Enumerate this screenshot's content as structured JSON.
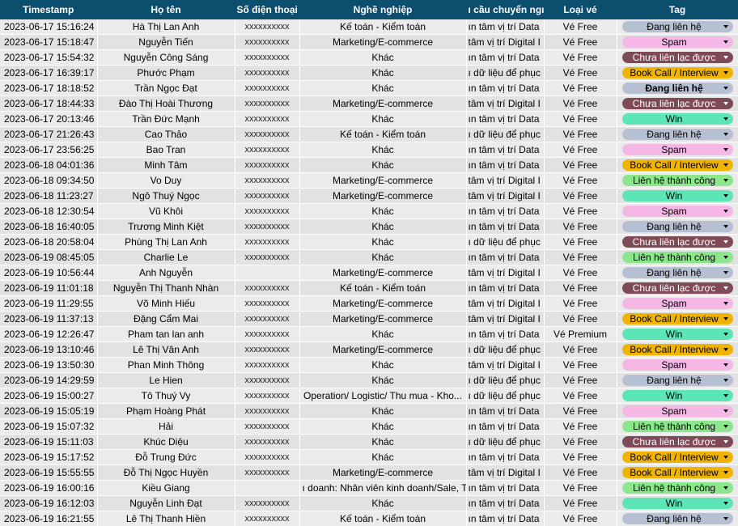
{
  "headers": [
    "Timestamp",
    "Họ tên",
    "Số điện thoại",
    "Nghề nghiệp",
    "ı cầu chuyển ngı",
    "Loại vé",
    "Tag"
  ],
  "tag_styles": {
    "Đang liên hệ": "lien",
    "Spam": "spam",
    "Chưa liên lạc được": "chua",
    "Book Call / Interview": "book",
    "Win": "win",
    "Liên hệ thành công": "thanh"
  },
  "rows": [
    {
      "ts": "2023-06-17 15:16:24",
      "name": "Hà Thị Lan Anh",
      "phone": "xxxxxxxxxx",
      "job": "Kế toán - Kiểm toán",
      "need": "ın tâm vị trí Data",
      "ticket": "Vé Free",
      "tag": "Đang liên hệ"
    },
    {
      "ts": "2023-06-17 15:18:47",
      "name": "Nguyễn Tiến",
      "phone": "xxxxxxxxxx",
      "job": "Marketing/E-commerce",
      "need": "tâm vị trí Digital I",
      "ticket": "Vé Free",
      "tag": "Spam"
    },
    {
      "ts": "2023-06-17 15:54:32",
      "name": "Nguyễn Công Sáng",
      "phone": "xxxxxxxxxx",
      "job": "Khác",
      "need": "ın tâm vị trí Data",
      "ticket": "Vé Free",
      "tag": "Chưa liên lạc được"
    },
    {
      "ts": "2023-06-17 16:39:17",
      "name": "Phước Phạm",
      "phone": "xxxxxxxxxx",
      "job": "Khác",
      "need": "ı dữ liệu để phục",
      "ticket": "Vé Free",
      "tag": "Book Call / Interview"
    },
    {
      "ts": "2023-06-17 18:18:52",
      "name": "Trần Ngọc Đạt",
      "phone": "xxxxxxxxxx",
      "job": "Khác",
      "need": "ın tâm vị trí Data",
      "ticket": "Vé Free",
      "tag": "Đang liên hệ",
      "bold": true
    },
    {
      "ts": "2023-06-17 18:44:33",
      "name": "Đào Thị Hoài Thương",
      "phone": "xxxxxxxxxx",
      "job": "Marketing/E-commerce",
      "need": "tâm vị trí Digital I",
      "ticket": "Vé Free",
      "tag": "Chưa liên lạc được"
    },
    {
      "ts": "2023-06-17 20:13:46",
      "name": "Trần Đức Mạnh",
      "phone": "xxxxxxxxxx",
      "job": "Khác",
      "need": "ın tâm vị trí Data",
      "ticket": "Vé Free",
      "tag": "Win"
    },
    {
      "ts": "2023-06-17 21:26:43",
      "name": "Cao Thảo",
      "phone": "xxxxxxxxxx",
      "job": "Kế toán - Kiểm toán",
      "need": "ı dữ liệu để phục",
      "ticket": "Vé Free",
      "tag": "Đang liên hệ"
    },
    {
      "ts": "2023-06-17 23:56:25",
      "name": "Bao Tran",
      "phone": "xxxxxxxxxx",
      "job": "Khác",
      "need": "ın tâm vị trí Data",
      "ticket": "Vé Free",
      "tag": "Spam"
    },
    {
      "ts": "2023-06-18 04:01:36",
      "name": "Minh Tâm",
      "phone": "xxxxxxxxxx",
      "job": "Khác",
      "need": "ın tâm vị trí Data",
      "ticket": "Vé Free",
      "tag": "Book Call / Interview"
    },
    {
      "ts": "2023-06-18 09:34:50",
      "name": "Vo Duy",
      "phone": "xxxxxxxxxx",
      "job": "Marketing/E-commerce",
      "need": "tâm vị trí Digital I",
      "ticket": "Vé Free",
      "tag": "Liên hệ thành công"
    },
    {
      "ts": "2023-06-18 11:23:27",
      "name": "Ngô Thuý Ngọc",
      "phone": "xxxxxxxxxx",
      "job": "Marketing/E-commerce",
      "need": "tâm vị trí Digital I",
      "ticket": "Vé Free",
      "tag": "Win"
    },
    {
      "ts": "2023-06-18 12:30:54",
      "name": "Vũ Khôi",
      "phone": "xxxxxxxxxx",
      "job": "Khác",
      "need": "ın tâm vị trí Data",
      "ticket": "Vé Free",
      "tag": "Spam"
    },
    {
      "ts": "2023-06-18 16:40:05",
      "name": "Trương Minh Kiệt",
      "phone": "xxxxxxxxxx",
      "job": "Khác",
      "need": "ın tâm vị trí Data",
      "ticket": "Vé Free",
      "tag": "Đang liên hệ"
    },
    {
      "ts": "2023-06-18 20:58:04",
      "name": "Phùng Thị Lan Anh",
      "phone": "xxxxxxxxxx",
      "job": "Khác",
      "need": "ı dữ liệu để phục",
      "ticket": "Vé Free",
      "tag": "Chưa liên lạc được"
    },
    {
      "ts": "2023-06-19 08:45:05",
      "name": "Charlie Le",
      "phone": "xxxxxxxxxx",
      "job": "Khác",
      "need": "ın tâm vị trí Data",
      "ticket": "Vé Free",
      "tag": "Liên hệ thành công"
    },
    {
      "ts": "2023-06-19 10:56:44",
      "name": "Anh Nguyễn",
      "phone": "",
      "job": "Marketing/E-commerce",
      "need": "tâm vị trí Digital I",
      "ticket": "Vé Free",
      "tag": "Đang liên hệ"
    },
    {
      "ts": "2023-06-19 11:01:18",
      "name": "Nguyễn Thị Thanh Nhàn",
      "phone": "xxxxxxxxxx",
      "job": "Kế toán - Kiểm toán",
      "need": "ın tâm vị trí Data",
      "ticket": "Vé Free",
      "tag": "Chưa liên lạc được"
    },
    {
      "ts": "2023-06-19 11:29:55",
      "name": "Võ Minh Hiếu",
      "phone": "xxxxxxxxxx",
      "job": "Marketing/E-commerce",
      "need": "tâm vị trí Digital I",
      "ticket": "Vé Free",
      "tag": "Spam"
    },
    {
      "ts": "2023-06-19 11:37:13",
      "name": "Đặng Cẩm Mai",
      "phone": "xxxxxxxxxx",
      "job": "Marketing/E-commerce",
      "need": "tâm vị trí Digital I",
      "ticket": "Vé Free",
      "tag": "Book Call / Interview"
    },
    {
      "ts": "2023-06-19 12:26:47",
      "name": "Pham tan lan anh",
      "phone": "xxxxxxxxxx",
      "job": "Khác",
      "need": "ın tâm vị trí Data",
      "ticket": "Vé Premium",
      "tag": "Win"
    },
    {
      "ts": "2023-06-19 13:10:46",
      "name": "Lê Thị Vân Anh",
      "phone": "xxxxxxxxxx",
      "job": "Marketing/E-commerce",
      "need": "ı dữ liệu để phục",
      "ticket": "Vé Free",
      "tag": "Book Call / Interview"
    },
    {
      "ts": "2023-06-19 13:50:30",
      "name": "Phan Minh Thông",
      "phone": "xxxxxxxxxx",
      "job": "Khác",
      "need": "tâm vị trí Digital I",
      "ticket": "Vé Free",
      "tag": "Spam"
    },
    {
      "ts": "2023-06-19 14:29:59",
      "name": "Le Hien",
      "phone": "xxxxxxxxxx",
      "job": "Khác",
      "need": "ı dữ liệu để phục",
      "ticket": "Vé Free",
      "tag": "Đang liên hệ"
    },
    {
      "ts": "2023-06-19 15:00:27",
      "name": "Tô Thuý Vy",
      "phone": "xxxxxxxxxx",
      "job": "Operation/ Logistic/ Thu mua - Kho...",
      "need": "ı dữ liệu để phục",
      "ticket": "Vé Free",
      "tag": "Win"
    },
    {
      "ts": "2023-06-19 15:05:19",
      "name": "Phạm Hoàng Phát",
      "phone": "xxxxxxxxxx",
      "job": "Khác",
      "need": "ın tâm vị trí Data",
      "ticket": "Vé Free",
      "tag": "Spam"
    },
    {
      "ts": "2023-06-19 15:07:32",
      "name": "Hải",
      "phone": "xxxxxxxxxx",
      "job": "Khác",
      "need": "ın tâm vị trí Data",
      "ticket": "Vé Free",
      "tag": "Liên hệ thành công"
    },
    {
      "ts": "2023-06-19 15:11:03",
      "name": "Khúc Diệu",
      "phone": "xxxxxxxxxx",
      "job": "Khác",
      "need": "ı dữ liệu để phục",
      "ticket": "Vé Free",
      "tag": "Chưa liên lạc được"
    },
    {
      "ts": "2023-06-19 15:17:52",
      "name": "Đỗ Trung Đức",
      "phone": "xxxxxxxxxx",
      "job": "Khác",
      "need": "ın tâm vị trí Data",
      "ticket": "Vé Free",
      "tag": "Book Call / Interview"
    },
    {
      "ts": "2023-06-19 15:55:55",
      "name": "Đỗ Thị Ngọc Huyền",
      "phone": "xxxxxxxxxx",
      "job": "Marketing/E-commerce",
      "need": "tâm vị trí Digital I",
      "ticket": "Vé Free",
      "tag": "Book Call / Interview"
    },
    {
      "ts": "2023-06-19 16:00:16",
      "name": "Kiều Giang",
      "phone": "",
      "job": "ı doanh: Nhân viên kinh doanh/Sale, Tư vấn viên, Chăm",
      "need": "ın tâm vị trí Data",
      "ticket": "Vé Free",
      "tag": "Liên hệ thành công"
    },
    {
      "ts": "2023-06-19 16:12:03",
      "name": "Nguyễn Linh Đạt",
      "phone": "xxxxxxxxxx",
      "job": "Khác",
      "need": "ın tâm vị trí Data",
      "ticket": "Vé Free",
      "tag": "Win"
    },
    {
      "ts": "2023-06-19 16:21:55",
      "name": "Lê Thị Thanh Hiền",
      "phone": "xxxxxxxxxx",
      "job": "Kế toán - Kiểm toán",
      "need": "ın tâm vị trí Data",
      "ticket": "Vé Free",
      "tag": "Đang liên hệ"
    }
  ]
}
